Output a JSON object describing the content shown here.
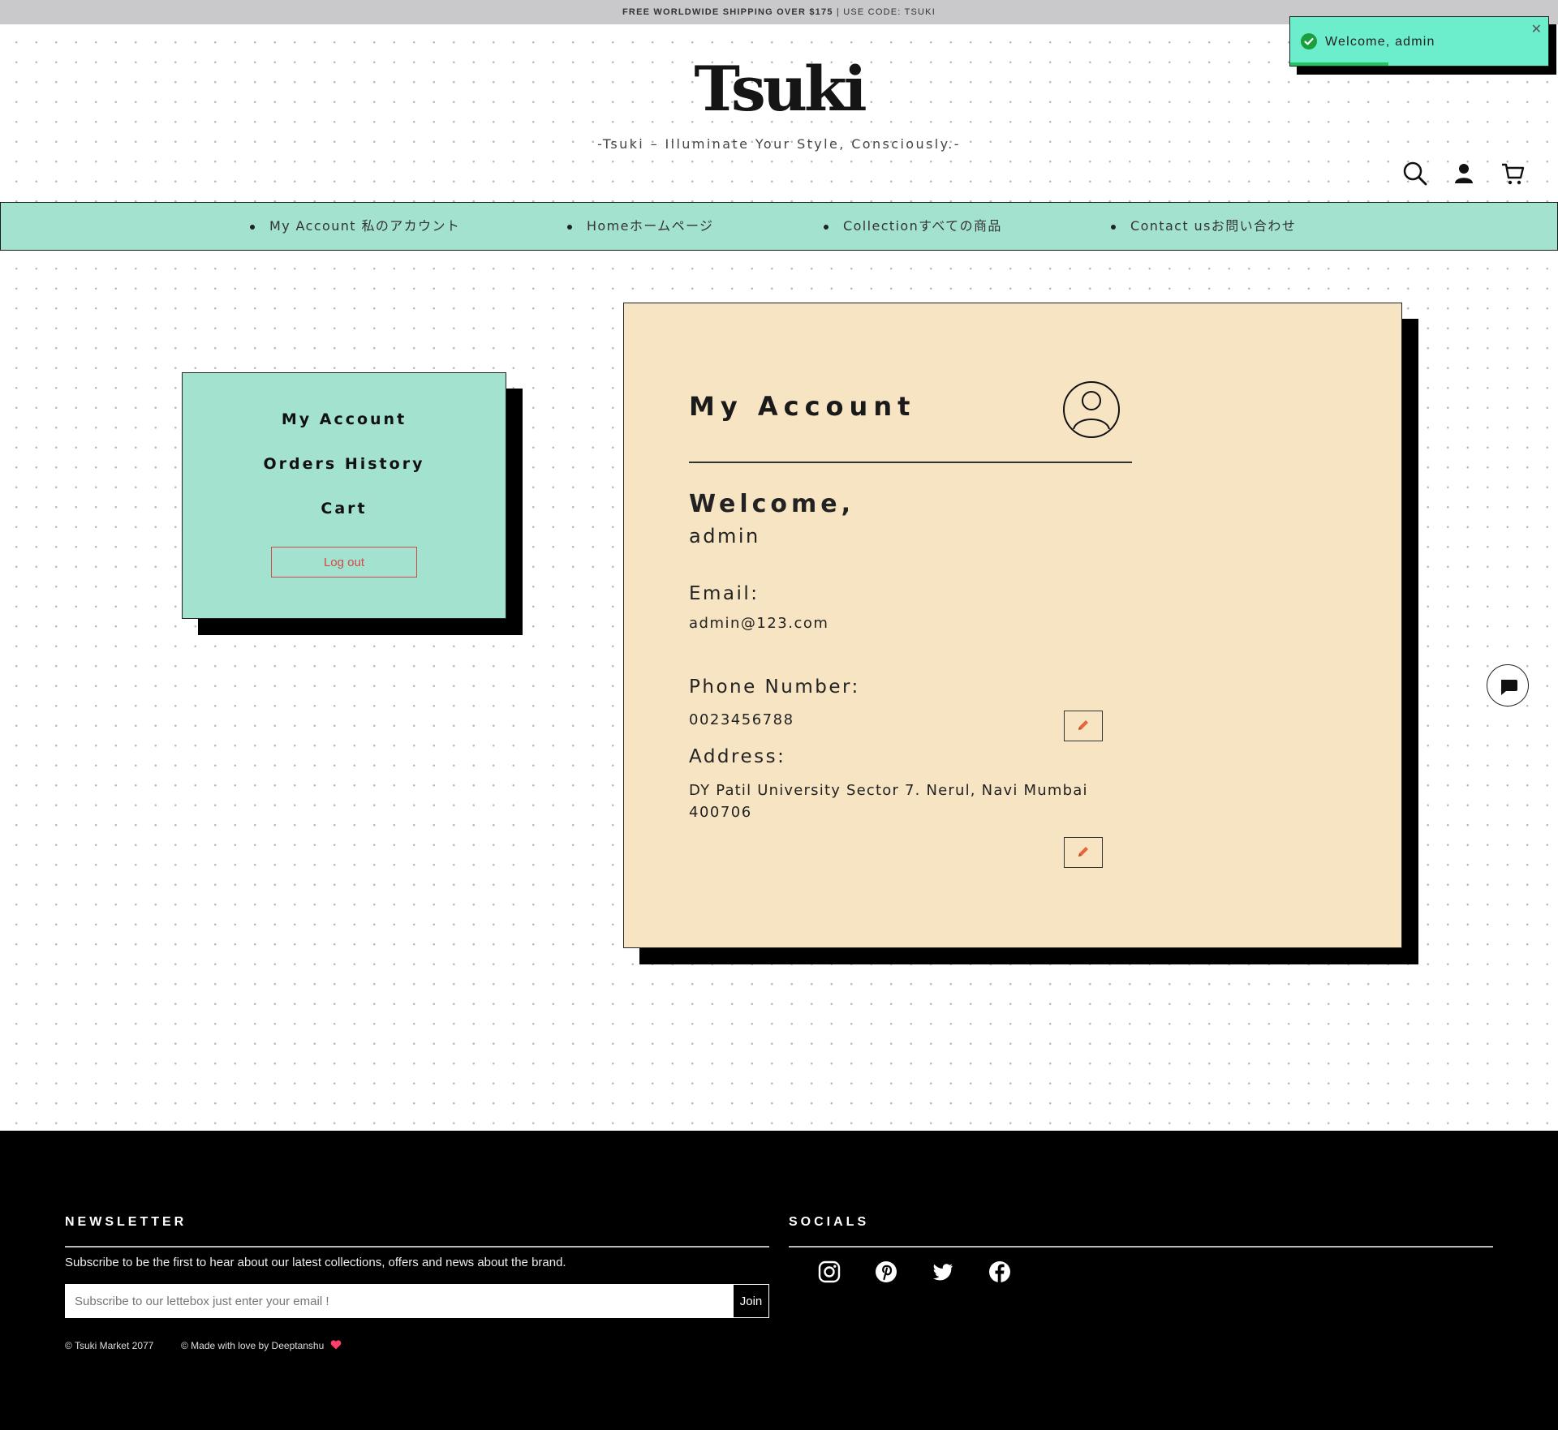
{
  "announcement": {
    "bold": "FREE WORLDWIDE SHIPPING OVER $175",
    "rest": " | USE CODE: TSUKI"
  },
  "header": {
    "logo": "Tsuki",
    "tagline": "-Tsuki – Illuminate Your Style, Consciously.-"
  },
  "nav": {
    "items": [
      {
        "label": "My Account 私のアカウント"
      },
      {
        "label": "Homeホームページ"
      },
      {
        "label": "Collectionすべての商品"
      },
      {
        "label": "Contact usお問い合わせ"
      }
    ]
  },
  "sidebar": {
    "links": [
      "My Account",
      "Orders History",
      "Cart"
    ],
    "logout": "Log out"
  },
  "account": {
    "title": "My Account",
    "welcome_label": "Welcome,",
    "username": "admin",
    "email_label": "Email:",
    "email": "admin@123.com",
    "phone_label": "Phone Number:",
    "phone": "0023456788",
    "address_label": "Address:",
    "address_line1": "DY Patil University Sector 7. Nerul, Navi Mumbai",
    "address_line2": "400706"
  },
  "toast": {
    "message": "Welcome, admin",
    "progress": 0.38,
    "accent": "#22c55e"
  },
  "footer": {
    "newsletter_heading": "NEWSLETTER",
    "newsletter_text": "Subscribe to be the first to hear about our latest collections, offers and news about the brand.",
    "email_placeholder": "Subscribe to our lettebox just enter your email !",
    "join_label": "Join",
    "copyright": "© Tsuki Market 2077",
    "credit": "© Made with love by Deeptanshu",
    "socials_heading": "SOCIALS",
    "social_icons": [
      "instagram-icon",
      "pinterest-icon",
      "twitter-icon",
      "facebook-icon"
    ]
  },
  "colors": {
    "mint": "#a4e2d0",
    "cream": "#f7e4c3",
    "danger": "#cf4a4a",
    "pencil": "#e8643a"
  }
}
